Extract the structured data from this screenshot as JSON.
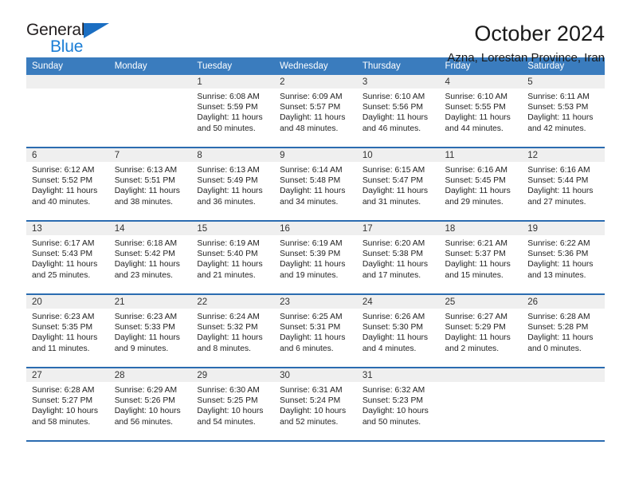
{
  "brand": {
    "name_top": "General",
    "name_bottom": "Blue",
    "triangle_icon": "triangle-icon",
    "accent_blue": "#1b7ed6",
    "dark": "#231f20"
  },
  "header": {
    "title": "October 2024",
    "subtitle": "Azna, Lorestan Province, Iran"
  },
  "theme": {
    "header_band": "#3a7cbe",
    "day_number_band": "#efefef",
    "week_divider": "#2b6cb0"
  },
  "weekdays": [
    "Sunday",
    "Monday",
    "Tuesday",
    "Wednesday",
    "Thursday",
    "Friday",
    "Saturday"
  ],
  "weeks": [
    [
      {
        "day": "",
        "blank": true
      },
      {
        "day": "",
        "blank": true
      },
      {
        "day": "1",
        "sunrise": "Sunrise: 6:08 AM",
        "sunset": "Sunset: 5:59 PM",
        "daylight_1": "Daylight: 11 hours",
        "daylight_2": "and 50 minutes."
      },
      {
        "day": "2",
        "sunrise": "Sunrise: 6:09 AM",
        "sunset": "Sunset: 5:57 PM",
        "daylight_1": "Daylight: 11 hours",
        "daylight_2": "and 48 minutes."
      },
      {
        "day": "3",
        "sunrise": "Sunrise: 6:10 AM",
        "sunset": "Sunset: 5:56 PM",
        "daylight_1": "Daylight: 11 hours",
        "daylight_2": "and 46 minutes."
      },
      {
        "day": "4",
        "sunrise": "Sunrise: 6:10 AM",
        "sunset": "Sunset: 5:55 PM",
        "daylight_1": "Daylight: 11 hours",
        "daylight_2": "and 44 minutes."
      },
      {
        "day": "5",
        "sunrise": "Sunrise: 6:11 AM",
        "sunset": "Sunset: 5:53 PM",
        "daylight_1": "Daylight: 11 hours",
        "daylight_2": "and 42 minutes."
      }
    ],
    [
      {
        "day": "6",
        "sunrise": "Sunrise: 6:12 AM",
        "sunset": "Sunset: 5:52 PM",
        "daylight_1": "Daylight: 11 hours",
        "daylight_2": "and 40 minutes."
      },
      {
        "day": "7",
        "sunrise": "Sunrise: 6:13 AM",
        "sunset": "Sunset: 5:51 PM",
        "daylight_1": "Daylight: 11 hours",
        "daylight_2": "and 38 minutes."
      },
      {
        "day": "8",
        "sunrise": "Sunrise: 6:13 AM",
        "sunset": "Sunset: 5:49 PM",
        "daylight_1": "Daylight: 11 hours",
        "daylight_2": "and 36 minutes."
      },
      {
        "day": "9",
        "sunrise": "Sunrise: 6:14 AM",
        "sunset": "Sunset: 5:48 PM",
        "daylight_1": "Daylight: 11 hours",
        "daylight_2": "and 34 minutes."
      },
      {
        "day": "10",
        "sunrise": "Sunrise: 6:15 AM",
        "sunset": "Sunset: 5:47 PM",
        "daylight_1": "Daylight: 11 hours",
        "daylight_2": "and 31 minutes."
      },
      {
        "day": "11",
        "sunrise": "Sunrise: 6:16 AM",
        "sunset": "Sunset: 5:45 PM",
        "daylight_1": "Daylight: 11 hours",
        "daylight_2": "and 29 minutes."
      },
      {
        "day": "12",
        "sunrise": "Sunrise: 6:16 AM",
        "sunset": "Sunset: 5:44 PM",
        "daylight_1": "Daylight: 11 hours",
        "daylight_2": "and 27 minutes."
      }
    ],
    [
      {
        "day": "13",
        "sunrise": "Sunrise: 6:17 AM",
        "sunset": "Sunset: 5:43 PM",
        "daylight_1": "Daylight: 11 hours",
        "daylight_2": "and 25 minutes."
      },
      {
        "day": "14",
        "sunrise": "Sunrise: 6:18 AM",
        "sunset": "Sunset: 5:42 PM",
        "daylight_1": "Daylight: 11 hours",
        "daylight_2": "and 23 minutes."
      },
      {
        "day": "15",
        "sunrise": "Sunrise: 6:19 AM",
        "sunset": "Sunset: 5:40 PM",
        "daylight_1": "Daylight: 11 hours",
        "daylight_2": "and 21 minutes."
      },
      {
        "day": "16",
        "sunrise": "Sunrise: 6:19 AM",
        "sunset": "Sunset: 5:39 PM",
        "daylight_1": "Daylight: 11 hours",
        "daylight_2": "and 19 minutes."
      },
      {
        "day": "17",
        "sunrise": "Sunrise: 6:20 AM",
        "sunset": "Sunset: 5:38 PM",
        "daylight_1": "Daylight: 11 hours",
        "daylight_2": "and 17 minutes."
      },
      {
        "day": "18",
        "sunrise": "Sunrise: 6:21 AM",
        "sunset": "Sunset: 5:37 PM",
        "daylight_1": "Daylight: 11 hours",
        "daylight_2": "and 15 minutes."
      },
      {
        "day": "19",
        "sunrise": "Sunrise: 6:22 AM",
        "sunset": "Sunset: 5:36 PM",
        "daylight_1": "Daylight: 11 hours",
        "daylight_2": "and 13 minutes."
      }
    ],
    [
      {
        "day": "20",
        "sunrise": "Sunrise: 6:23 AM",
        "sunset": "Sunset: 5:35 PM",
        "daylight_1": "Daylight: 11 hours",
        "daylight_2": "and 11 minutes."
      },
      {
        "day": "21",
        "sunrise": "Sunrise: 6:23 AM",
        "sunset": "Sunset: 5:33 PM",
        "daylight_1": "Daylight: 11 hours",
        "daylight_2": "and 9 minutes."
      },
      {
        "day": "22",
        "sunrise": "Sunrise: 6:24 AM",
        "sunset": "Sunset: 5:32 PM",
        "daylight_1": "Daylight: 11 hours",
        "daylight_2": "and 8 minutes."
      },
      {
        "day": "23",
        "sunrise": "Sunrise: 6:25 AM",
        "sunset": "Sunset: 5:31 PM",
        "daylight_1": "Daylight: 11 hours",
        "daylight_2": "and 6 minutes."
      },
      {
        "day": "24",
        "sunrise": "Sunrise: 6:26 AM",
        "sunset": "Sunset: 5:30 PM",
        "daylight_1": "Daylight: 11 hours",
        "daylight_2": "and 4 minutes."
      },
      {
        "day": "25",
        "sunrise": "Sunrise: 6:27 AM",
        "sunset": "Sunset: 5:29 PM",
        "daylight_1": "Daylight: 11 hours",
        "daylight_2": "and 2 minutes."
      },
      {
        "day": "26",
        "sunrise": "Sunrise: 6:28 AM",
        "sunset": "Sunset: 5:28 PM",
        "daylight_1": "Daylight: 11 hours",
        "daylight_2": "and 0 minutes."
      }
    ],
    [
      {
        "day": "27",
        "sunrise": "Sunrise: 6:28 AM",
        "sunset": "Sunset: 5:27 PM",
        "daylight_1": "Daylight: 10 hours",
        "daylight_2": "and 58 minutes."
      },
      {
        "day": "28",
        "sunrise": "Sunrise: 6:29 AM",
        "sunset": "Sunset: 5:26 PM",
        "daylight_1": "Daylight: 10 hours",
        "daylight_2": "and 56 minutes."
      },
      {
        "day": "29",
        "sunrise": "Sunrise: 6:30 AM",
        "sunset": "Sunset: 5:25 PM",
        "daylight_1": "Daylight: 10 hours",
        "daylight_2": "and 54 minutes."
      },
      {
        "day": "30",
        "sunrise": "Sunrise: 6:31 AM",
        "sunset": "Sunset: 5:24 PM",
        "daylight_1": "Daylight: 10 hours",
        "daylight_2": "and 52 minutes."
      },
      {
        "day": "31",
        "sunrise": "Sunrise: 6:32 AM",
        "sunset": "Sunset: 5:23 PM",
        "daylight_1": "Daylight: 10 hours",
        "daylight_2": "and 50 minutes."
      },
      {
        "day": "",
        "blank": true
      },
      {
        "day": "",
        "blank": true
      }
    ]
  ]
}
